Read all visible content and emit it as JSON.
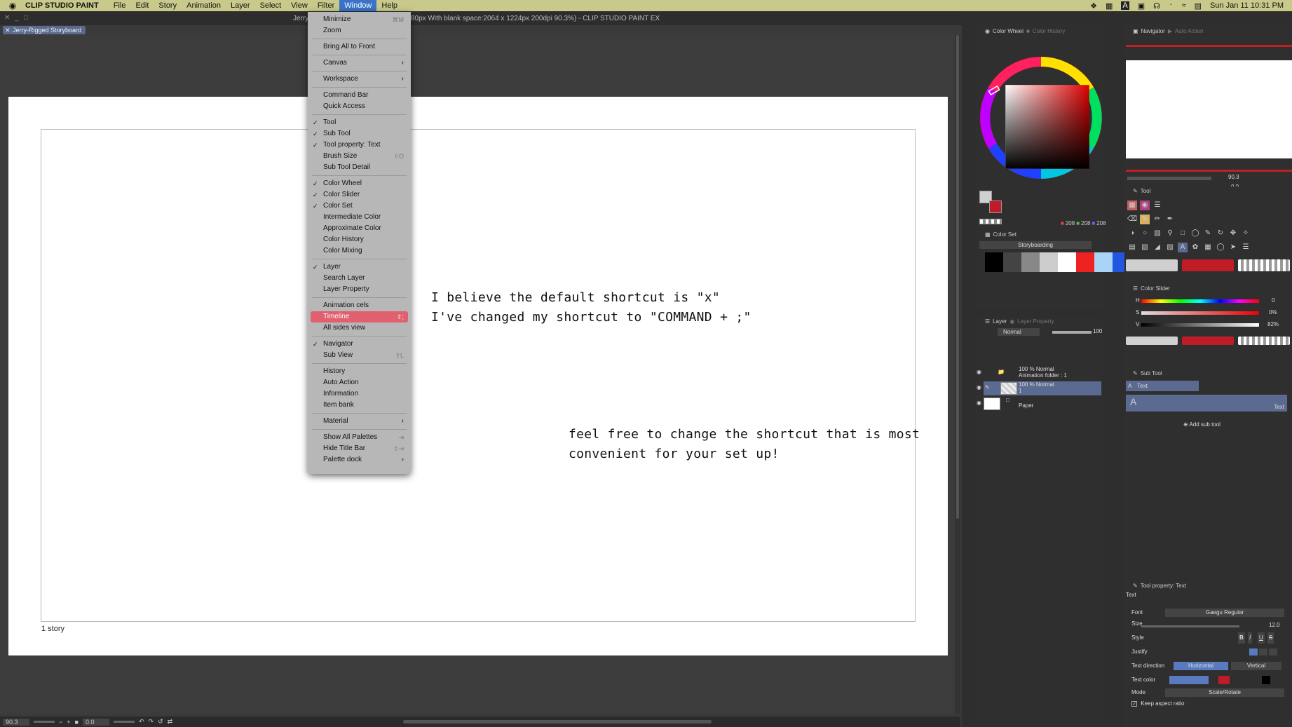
{
  "menubar": {
    "apple": "",
    "app_name": "CLIP STUDIO PAINT",
    "items": [
      "File",
      "Edit",
      "Story",
      "Animation",
      "Layer",
      "Select",
      "View",
      "Filter",
      "Window",
      "Help"
    ],
    "active": "Window",
    "datetime": "Sun Jan 11  10:31 PM",
    "input_badge": "A"
  },
  "window": {
    "title": "Jerry-Rigged Storyboard (1880 x 1080px With blank space:2064 x 1224px 200dpi 90.3%)  - CLIP STUDIO PAINT EX",
    "title_visible": "80px With blank space:2064 x 1224px 200dpi 90.3%)  - CLIP STUDIO PAINT EX",
    "title_prefix": "Jerry",
    "doc_tab": "Jerry-Rigged Storyboard"
  },
  "canvas": {
    "story_label": "1 story",
    "note1_line1": "I believe the default shortcut is  \"x\"",
    "note1_line2": "I've changed my shortcut to \"COMMAND + ;\"",
    "note2_line1": "feel free to change the shortcut that is most",
    "note2_line2": "convenient for your set up!"
  },
  "statusbar": {
    "zoom": "90.3",
    "angle": "0.0"
  },
  "window_menu": {
    "items": [
      {
        "label": "Minimize",
        "shortcut": "⌘M"
      },
      {
        "label": "Zoom"
      },
      {
        "sep": true
      },
      {
        "label": "Bring All to Front"
      },
      {
        "sep": true
      },
      {
        "label": "Canvas",
        "submenu": true
      },
      {
        "sep": true
      },
      {
        "label": "Workspace",
        "submenu": true
      },
      {
        "sep": true
      },
      {
        "label": "Command Bar"
      },
      {
        "label": "Quick Access"
      },
      {
        "sep": true
      },
      {
        "label": "Tool",
        "checked": true
      },
      {
        "label": "Sub Tool",
        "checked": true
      },
      {
        "label": "Tool property: Text",
        "checked": true
      },
      {
        "label": "Brush Size",
        "shortcut": "⇧O"
      },
      {
        "label": "Sub Tool Detail"
      },
      {
        "sep": true
      },
      {
        "label": "Color Wheel",
        "checked": true
      },
      {
        "label": "Color Slider",
        "checked": true
      },
      {
        "label": "Color Set",
        "checked": true
      },
      {
        "label": "Intermediate Color"
      },
      {
        "label": "Approximate Color"
      },
      {
        "label": "Color History"
      },
      {
        "label": "Color Mixing"
      },
      {
        "sep": true
      },
      {
        "label": "Layer",
        "checked": true
      },
      {
        "label": "Search Layer"
      },
      {
        "label": "Layer Property"
      },
      {
        "sep": true
      },
      {
        "label": "Animation cels"
      },
      {
        "label": "Timeline",
        "highlight": true,
        "shortcut": "⇧;"
      },
      {
        "label": "All sides view"
      },
      {
        "sep": true
      },
      {
        "label": "Navigator",
        "checked": true
      },
      {
        "label": "Sub View",
        "shortcut": "⇧L"
      },
      {
        "sep": true
      },
      {
        "label": "History"
      },
      {
        "label": "Auto Action"
      },
      {
        "label": "Information"
      },
      {
        "label": "Item bank"
      },
      {
        "sep": true
      },
      {
        "label": "Material",
        "submenu": true
      },
      {
        "sep": true
      },
      {
        "label": "Show All Palettes",
        "shortcut": "⇥"
      },
      {
        "label": "Hide Title Bar",
        "shortcut": "⇧⇥"
      },
      {
        "label": "Palette dock",
        "submenu": true
      }
    ]
  },
  "panels": {
    "color_wheel_tab": "Color Wheel",
    "color_history_tab": "Color History",
    "rgb_r": "208",
    "rgb_g": "208",
    "rgb_b": "208",
    "color_set_tab": "Color Set",
    "color_set_name": "Storyboarding",
    "color_set_swatches": [
      "#000000",
      "#444444",
      "#888888",
      "#cccccc",
      "#ffffff",
      "#ee2222",
      "#aad4f5",
      "#2255e0"
    ],
    "layer_tab": "Layer",
    "layer_property_tab": "Layer Property",
    "blend_mode": "Normal",
    "opacity": "100",
    "layers": [
      {
        "line1": "100 % Normal",
        "line2": "Animation folder : 1"
      },
      {
        "line1": "100 % Normal",
        "line2": "1",
        "selected": true
      },
      {
        "line1": "Paper"
      }
    ],
    "navigator_tab": "Navigator",
    "auto_action_tab": "Auto Action",
    "nav_zoom": "90.3",
    "nav_angle": "0.0",
    "tool_tab": "Tool",
    "color_slider_tab": "Color Slider",
    "hsv": {
      "h_label": "H",
      "s_label": "S",
      "v_label": "V",
      "h": "0",
      "s": "0%",
      "v": "82%"
    },
    "sub_tool_tab": "Sub Tool",
    "sub_tool_group": "Text",
    "sub_tool_item": "Text",
    "add_sub_tool": "Add sub tool",
    "tool_property_tab": "Tool property: Text",
    "tool_property_name": "Text",
    "props": {
      "font_label": "Font",
      "font_value": "Gaegu Regular",
      "size_label": "Size",
      "size_value": "12.0",
      "style_label": "Style",
      "justify_label": "Justify",
      "direction_label": "Text direction",
      "direction_h": "Horizontal",
      "direction_v": "Vertical",
      "color_label": "Text color",
      "mode_label": "Mode",
      "mode_value": "Scale/Rotate",
      "keep_aspect": "Keep aspect ratio"
    }
  },
  "colors": {
    "accent": "#e06070",
    "menubar": "#c8c98a",
    "main_red": "#c01c28",
    "selection": "#5a6a90"
  }
}
